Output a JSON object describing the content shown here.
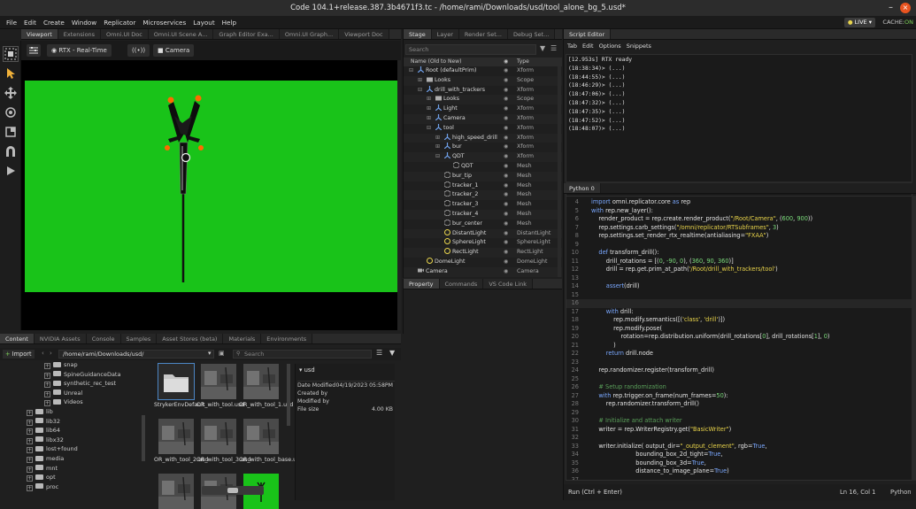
{
  "window": {
    "title": "Code 104.1+release.387.3b4671f3.tc - /home/rami/Downloads/usd/tool_alone_bg_5.usd*",
    "minimize": "–",
    "close": "×"
  },
  "menu": [
    "File",
    "Edit",
    "Create",
    "Window",
    "Replicator",
    "Microservices",
    "Layout",
    "Help"
  ],
  "status": {
    "live_star": "●",
    "live": "LIVE",
    "live_caret": "▾",
    "cache_label": "CACHE:",
    "cache_value": "ON"
  },
  "viewport_tabs": [
    "Viewport",
    "Extensions",
    "Omni.UI Doc",
    "Omni.UI Scene A...",
    "Graph Editor Exa...",
    "Omni.UI Graph...",
    "Viewport Doc"
  ],
  "viewport_toolbar": {
    "render_mode": "RTX - Real-Time",
    "camera": "Camera"
  },
  "stage": {
    "tabs": [
      "Stage",
      "Layer",
      "Render Set...",
      "Debug Set..."
    ],
    "search_placeholder": "Search",
    "col_name": "Name (Old to New)",
    "col_type": "Type",
    "rows": [
      {
        "name": "Root (defaultPrim)",
        "type": "Xform",
        "icon": "xform",
        "indent": 0,
        "exp": "⊟"
      },
      {
        "name": "Looks",
        "type": "Scope",
        "icon": "folder",
        "indent": 1,
        "exp": "⊞"
      },
      {
        "name": "drill_with_trackers",
        "type": "Xform",
        "icon": "xform",
        "indent": 1,
        "exp": "⊟"
      },
      {
        "name": "Looks",
        "type": "Scope",
        "icon": "folder",
        "indent": 2,
        "exp": "⊞"
      },
      {
        "name": "Light",
        "type": "Xform",
        "icon": "xform",
        "indent": 2,
        "exp": "⊞"
      },
      {
        "name": "Camera",
        "type": "Xform",
        "icon": "xform",
        "indent": 2,
        "exp": "⊞"
      },
      {
        "name": "tool",
        "type": "Xform",
        "icon": "xform",
        "indent": 2,
        "exp": "⊟"
      },
      {
        "name": "high_speed_drill",
        "type": "Xform",
        "icon": "xform",
        "indent": 3,
        "exp": "⊞"
      },
      {
        "name": "bur",
        "type": "Xform",
        "icon": "xform",
        "indent": 3,
        "exp": "⊞"
      },
      {
        "name": "QDT",
        "type": "Xform",
        "icon": "xform",
        "indent": 3,
        "exp": "⊟"
      },
      {
        "name": "QDT",
        "type": "Mesh",
        "icon": "mesh",
        "indent": 4,
        "exp": ""
      },
      {
        "name": "bur_tip",
        "type": "Mesh",
        "icon": "mesh",
        "indent": 3,
        "exp": ""
      },
      {
        "name": "tracker_1",
        "type": "Mesh",
        "icon": "mesh",
        "indent": 3,
        "exp": ""
      },
      {
        "name": "tracker_2",
        "type": "Mesh",
        "icon": "mesh",
        "indent": 3,
        "exp": ""
      },
      {
        "name": "tracker_3",
        "type": "Mesh",
        "icon": "mesh",
        "indent": 3,
        "exp": ""
      },
      {
        "name": "tracker_4",
        "type": "Mesh",
        "icon": "mesh",
        "indent": 3,
        "exp": ""
      },
      {
        "name": "bur_center",
        "type": "Mesh",
        "icon": "mesh",
        "indent": 3,
        "exp": ""
      },
      {
        "name": "DistantLight",
        "type": "DistantLight",
        "icon": "light",
        "indent": 3,
        "exp": ""
      },
      {
        "name": "SphereLight",
        "type": "SphereLight",
        "icon": "light",
        "indent": 3,
        "exp": ""
      },
      {
        "name": "RectLight",
        "type": "RectLight",
        "icon": "light",
        "indent": 3,
        "exp": ""
      },
      {
        "name": "DomeLight",
        "type": "DomeLight",
        "icon": "light",
        "indent": 1,
        "exp": ""
      },
      {
        "name": "Camera",
        "type": "Camera",
        "icon": "camera",
        "indent": 0,
        "exp": ""
      }
    ]
  },
  "property_tabs": [
    "Property",
    "Commands",
    "VS Code Link"
  ],
  "script_editor": {
    "title": "Script Editor",
    "menu": [
      "Tab",
      "Edit",
      "Options",
      "Snippets"
    ],
    "output": [
      "[12.953s] RTX ready",
      "(18:38:34)> (...)",
      "(18:44:55)> (...)",
      "(18:46:29)> (...)",
      "(18:47:06)> (...)",
      "(18:47:32)> (...)",
      "(18:47:35)> (...)",
      "(18:47:52)> (...)",
      "(18:48:07)> (...)"
    ],
    "code_tab": "Python 0",
    "run_button": "Run (Ctrl + Enter)",
    "cursor": "Ln 16, Col 1",
    "language": "Python"
  },
  "code": [
    {
      "n": "4",
      "html": "<span class='kw'>import</span> omni.replicator.core <span class='kw'>as</span> rep"
    },
    {
      "n": "5",
      "html": "<span class='kw'>with</span> rep.new_layer():"
    },
    {
      "n": "6",
      "html": "    render_product = rep.create.render_product(<span class='st'>\"/Root/Camera\"</span>, (<span class='nu'>600</span>, <span class='nu'>900</span>))"
    },
    {
      "n": "7",
      "html": "    rep.settings.carb_settings(<span class='st'>\"/omni/replicator/RTSubframes\"</span>, <span class='nu'>3</span>)"
    },
    {
      "n": "8",
      "html": "    rep.settings.set_render_rtx_realtime(antialiasing=<span class='st'>\"FXAA\"</span>)"
    },
    {
      "n": "9",
      "html": ""
    },
    {
      "n": "10",
      "html": "    <span class='kw'>def</span> transform_drill():"
    },
    {
      "n": "11",
      "html": "        drill_rotations = [(<span class='nu'>0</span>, <span class='nu'>-90</span>, <span class='nu'>0</span>), (<span class='nu'>360</span>, <span class='nu'>90</span>, <span class='nu'>360</span>)]"
    },
    {
      "n": "12",
      "html": "        drill = rep.get.prim_at_path(<span class='st'>'/Root/drill_with_trackers/tool'</span>)"
    },
    {
      "n": "13",
      "html": ""
    },
    {
      "n": "14",
      "html": "        <span class='kw'>assert</span>(drill)"
    },
    {
      "n": "15",
      "html": ""
    },
    {
      "n": "16",
      "html": ""
    },
    {
      "n": "17",
      "html": "        <span class='kw'>with</span> drill:"
    },
    {
      "n": "18",
      "html": "            rep.modify.semantics([(<span class='st'>'class'</span>, <span class='st'>'drill'</span>)])"
    },
    {
      "n": "19",
      "html": "            rep.modify.pose("
    },
    {
      "n": "20",
      "html": "                rotation=rep.distribution.uniform(drill_rotations[<span class='nu'>0</span>], drill_rotations[<span class='nu'>1</span>], <span class='nu'>0</span>)"
    },
    {
      "n": "21",
      "html": "            )"
    },
    {
      "n": "22",
      "html": "        <span class='kw'>return</span> drill.node"
    },
    {
      "n": "23",
      "html": ""
    },
    {
      "n": "24",
      "html": "    rep.randomizer.register(transform_drill)"
    },
    {
      "n": "25",
      "html": ""
    },
    {
      "n": "26",
      "html": "    <span class='cm'># Setup randomization</span>"
    },
    {
      "n": "27",
      "html": "    <span class='kw'>with</span> rep.trigger.on_frame(num_frames=<span class='nu'>50</span>):"
    },
    {
      "n": "28",
      "html": "        rep.randomizer.transform_drill()"
    },
    {
      "n": "29",
      "html": ""
    },
    {
      "n": "30",
      "html": "    <span class='cm'># Initialize and attach writer</span>"
    },
    {
      "n": "31",
      "html": "    writer = rep.WriterRegistry.get(<span class='st'>\"BasicWriter\"</span>)"
    },
    {
      "n": "32",
      "html": ""
    },
    {
      "n": "33",
      "html": "    writer.initialize( output_dir=<span class='st'>\"_output_clement\"</span>, rgb=<span class='kw'>True</span>,"
    },
    {
      "n": "34",
      "html": "                        bounding_box_2d_tight=<span class='kw'>True</span>,"
    },
    {
      "n": "35",
      "html": "                        bounding_box_3d=<span class='kw'>True</span>,"
    },
    {
      "n": "36",
      "html": "                        distance_to_image_plane=<span class='kw'>True</span>)"
    },
    {
      "n": "37",
      "html": ""
    },
    {
      "n": "38",
      "html": "    writer.attach([render_product])"
    },
    {
      "n": "39",
      "html": ""
    },
    {
      "n": "40",
      "html": "    rep.orchestrator.run()"
    }
  ],
  "content": {
    "tabs": [
      "Content",
      "NVIDIA Assets",
      "Console",
      "Samples",
      "Asset Stores (beta)",
      "Materials",
      "Environments"
    ],
    "import_label": "Import",
    "path": "/home/rami/Downloads/usd/",
    "search_placeholder": "Search",
    "tree": [
      {
        "name": "snap",
        "level": 1,
        "exp": "+"
      },
      {
        "name": "SpineGuidanceData",
        "level": 1,
        "exp": "+"
      },
      {
        "name": "synthetic_rec_test",
        "level": 1,
        "exp": "+"
      },
      {
        "name": "Unreal",
        "level": 1,
        "exp": "+"
      },
      {
        "name": "Videos",
        "level": 1,
        "exp": "+"
      },
      {
        "name": "lib",
        "level": 0,
        "exp": "+"
      },
      {
        "name": "lib32",
        "level": 0,
        "exp": "+"
      },
      {
        "name": "lib64",
        "level": 0,
        "exp": "+"
      },
      {
        "name": "libx32",
        "level": 0,
        "exp": "+"
      },
      {
        "name": "lost+found",
        "level": 0,
        "exp": "+"
      },
      {
        "name": "media",
        "level": 0,
        "exp": "+"
      },
      {
        "name": "mnt",
        "level": 0,
        "exp": "+"
      },
      {
        "name": "opt",
        "level": 0,
        "exp": "+"
      },
      {
        "name": "proc",
        "level": 0,
        "exp": "+"
      }
    ],
    "files": [
      {
        "name": "StrykerEnvDefault",
        "thumb": "folder"
      },
      {
        "name": "OR_with_tool.usd",
        "thumb": "scene"
      },
      {
        "name": "OR_with_tool_1.usd",
        "thumb": "scene"
      },
      {
        "name": "OR_with_tool_2.usd",
        "thumb": "scene"
      },
      {
        "name": "OR_with_tool_3.usd",
        "thumb": "scene"
      },
      {
        "name": "OR_with_tool_base.usd",
        "thumb": "scene"
      },
      {
        "name": "",
        "thumb": "scene"
      },
      {
        "name": "",
        "thumb": "scene"
      },
      {
        "name": "",
        "thumb": "green"
      }
    ],
    "details": {
      "folder": "usd",
      "rows": [
        {
          "k": "Date Modified",
          "v": "04/19/2023 05:58PM"
        },
        {
          "k": "Created by",
          "v": ""
        },
        {
          "k": "Modified by",
          "v": ""
        },
        {
          "k": "File size",
          "v": "4.00 KB"
        }
      ]
    }
  }
}
